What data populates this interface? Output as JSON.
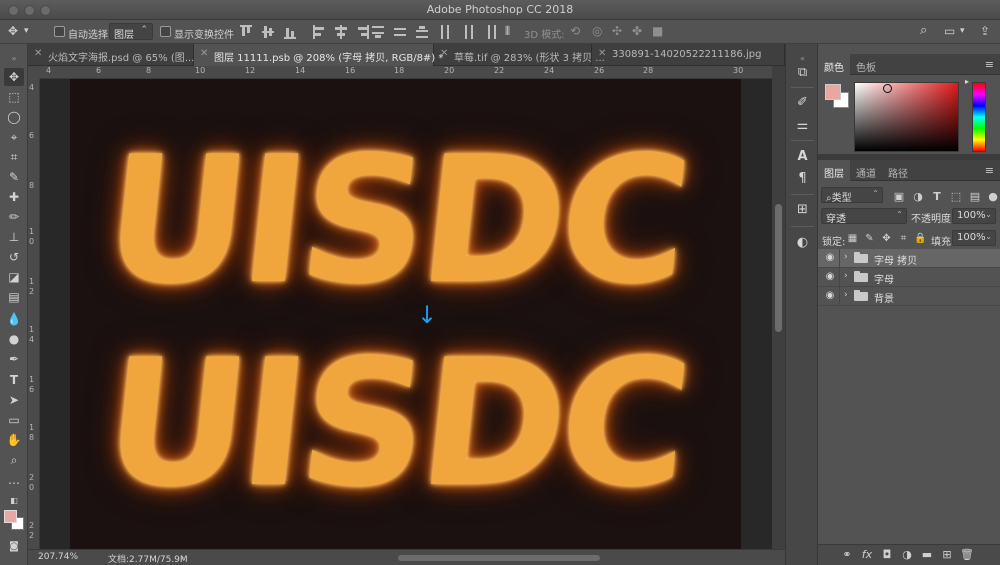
{
  "window": {
    "title": "Adobe Photoshop CC 2018"
  },
  "options_bar": {
    "auto_select_label": "自动选择:",
    "auto_select_value": "图层",
    "show_transform_label": "显示变换控件",
    "mode_3d_label": "3D 模式:"
  },
  "tabs": [
    {
      "label": "火焰文字海报.psd @ 65% (图..."
    },
    {
      "label": "图层 11111.psb @ 208% (字母 拷贝, RGB/8#) *"
    },
    {
      "label": "草莓.tif @ 283% (形状 3 拷贝 ..."
    },
    {
      "label": "330891-14020522211186.jpg"
    }
  ],
  "rulers": {
    "top": [
      "4",
      "6",
      "8",
      "10",
      "12",
      "14",
      "16",
      "18",
      "20",
      "22",
      "24",
      "26",
      "28",
      "30"
    ],
    "left": [
      "4",
      "6",
      "8",
      "1",
      "0",
      "1",
      "2",
      "1",
      "4",
      "1",
      "6",
      "1",
      "8",
      "2",
      "0",
      "2",
      "2"
    ]
  },
  "canvas": {
    "line1": "UISDC",
    "line2": "UISDC",
    "arrow": "↓"
  },
  "status": {
    "zoom": "207.74%",
    "doc": "文档:2.77M/75.9M"
  },
  "color_panel": {
    "tabs": [
      "颜色",
      "色板"
    ],
    "foreground": "#e8a7a0",
    "background": "#ffffff"
  },
  "layers_panel": {
    "tabs": [
      "图层",
      "通道",
      "路径"
    ],
    "filter_label": "类型",
    "blend_mode": "穿透",
    "opacity_label": "不透明度:",
    "opacity_value": "100%",
    "lock_label": "锁定:",
    "fill_label": "填充:",
    "fill_value": "100%",
    "layers": [
      {
        "name": "字母 拷贝",
        "selected": true
      },
      {
        "name": "字母",
        "selected": false
      },
      {
        "name": "背景",
        "selected": false
      }
    ]
  },
  "colors": {
    "arrow": "#1f9ae8",
    "fire": "#f0a63c",
    "canvas_bg": "#1a1110"
  }
}
